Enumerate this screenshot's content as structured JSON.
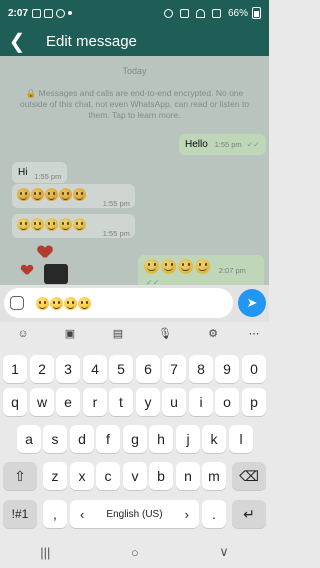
{
  "status_bar": {
    "time": "2:07",
    "battery": "66%"
  },
  "header": {
    "title": "Edit message",
    "back_glyph": "❮"
  },
  "chat": {
    "date_chip": "Today",
    "encryption_notice": "🔒 Messages and calls are end-to-end encrypted. No one outside of this chat, not even WhatsApp, can read or listen to them. Tap to learn more.",
    "messages": [
      {
        "text": "Hello",
        "time": "1:55 pm"
      },
      {
        "text": "Hi",
        "time": "1:55 pm"
      },
      {
        "time": "1:55 pm"
      },
      {
        "time": "1:55 pm"
      },
      {
        "time": "2:07 pm"
      }
    ]
  },
  "input": {
    "send_glyph": "➤"
  },
  "keyboard": {
    "row_numbers": [
      "1",
      "2",
      "3",
      "4",
      "5",
      "6",
      "7",
      "8",
      "9",
      "0"
    ],
    "row_1": [
      "q",
      "w",
      "e",
      "r",
      "t",
      "y",
      "u",
      "i",
      "o",
      "p"
    ],
    "row_2": [
      "a",
      "s",
      "d",
      "f",
      "g",
      "h",
      "j",
      "k",
      "l"
    ],
    "row_3": [
      "z",
      "x",
      "c",
      "v",
      "b",
      "n",
      "m"
    ],
    "symbols_key": "!#1",
    "comma_key": ",",
    "period_key": ".",
    "space_label": "English (US)",
    "shift_glyph": "⇧",
    "backspace_glyph": "⌫",
    "enter_glyph": "↵",
    "lang_left": "‹",
    "lang_right": "›",
    "tools": [
      "☺",
      "▣",
      "▤",
      "🎙",
      "⚙",
      "⋯"
    ]
  },
  "nav": {
    "recents": "|||",
    "home": "○",
    "back": "∨"
  },
  "colors": {
    "header": "#1f5e57",
    "outgoing": "#cfe9c6",
    "send": "#2196f3"
  }
}
